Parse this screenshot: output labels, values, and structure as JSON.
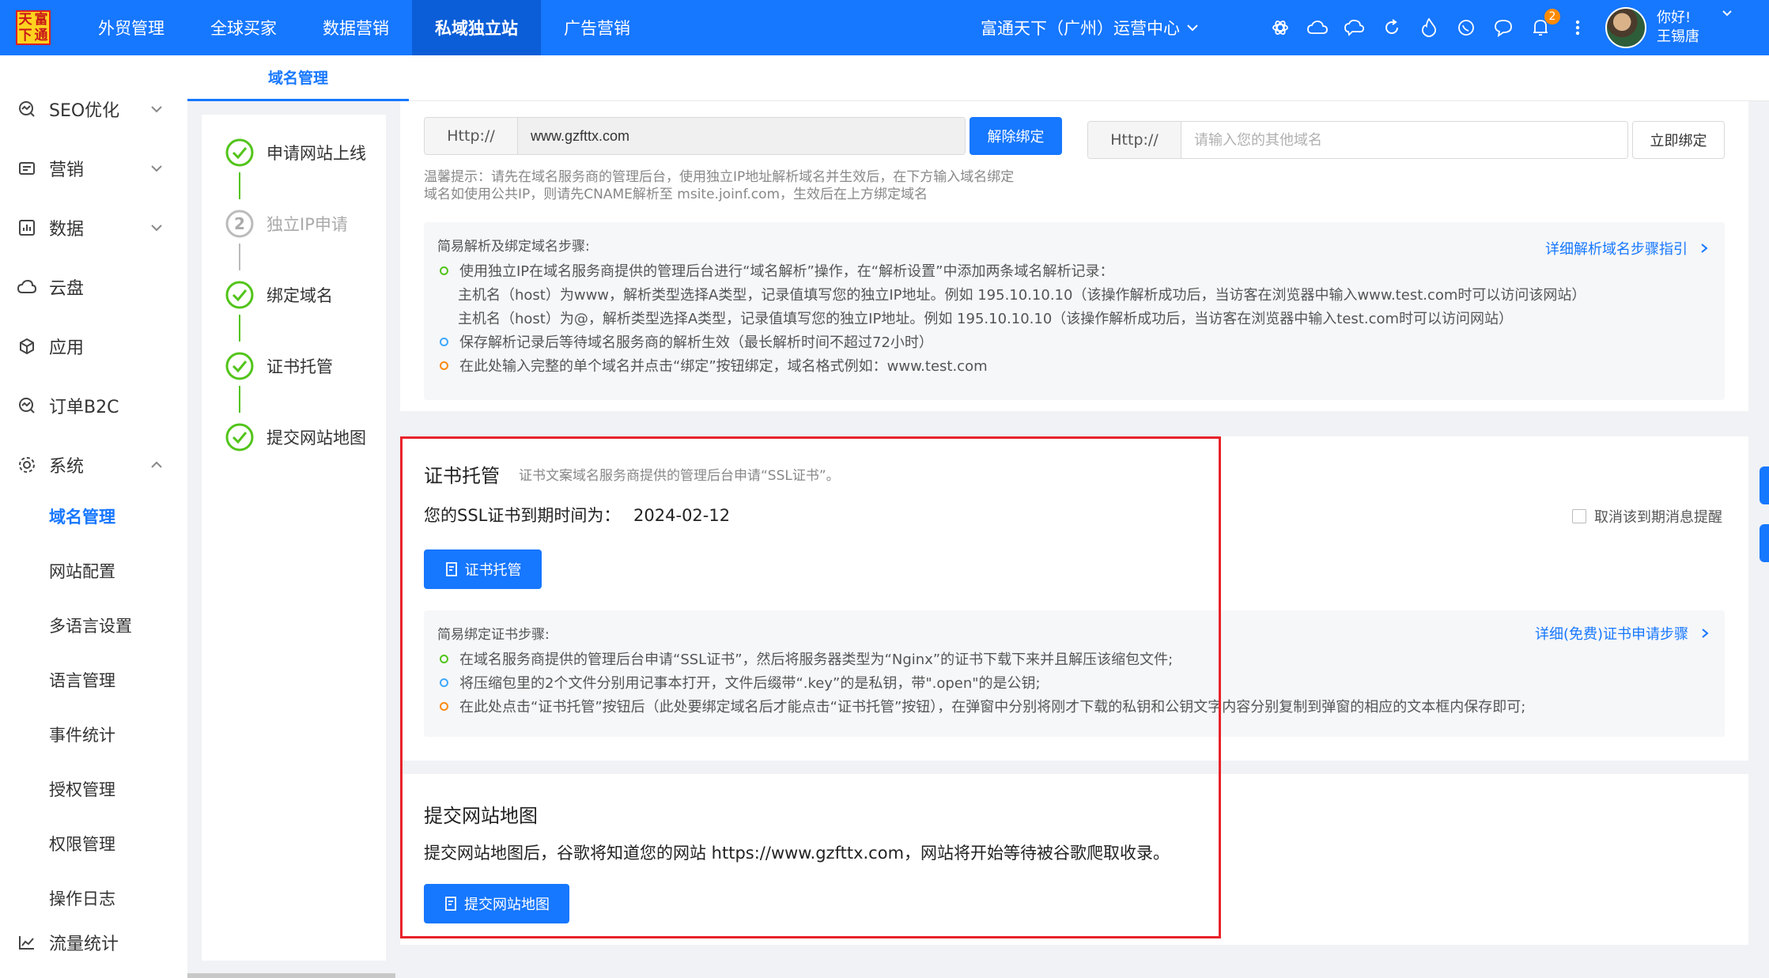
{
  "colors": {
    "primary": "#1677ff",
    "highlight": "#e8232a",
    "success": "#52c41a"
  },
  "logo": {
    "chars": [
      "天",
      "富",
      "下",
      "通"
    ]
  },
  "topnav": {
    "items": [
      "外贸管理",
      "全球买家",
      "数据营销",
      "私域独立站",
      "广告营销"
    ],
    "active": "私域独立站",
    "org": "富通天下（广州）运营中心",
    "icons": [
      "openai-icon",
      "cloud-icon",
      "cloud-chat-icon",
      "refresh-icon",
      "fire-icon",
      "whatsapp-icon",
      "chat-icon",
      "bell-icon",
      "more-icon"
    ],
    "bell_badge": "2",
    "user_greeting": "你好!",
    "user_name": "王锡唐"
  },
  "sidebar": {
    "items": [
      {
        "label": "SEO优化",
        "icon": "seo-icon",
        "expanded": false
      },
      {
        "label": "营销",
        "icon": "marketing-icon",
        "expanded": false
      },
      {
        "label": "数据",
        "icon": "data-icon",
        "expanded": false
      },
      {
        "label": "云盘",
        "icon": "cloud-disk-icon"
      },
      {
        "label": "应用",
        "icon": "app-icon"
      },
      {
        "label": "订单B2C",
        "icon": "order-icon"
      },
      {
        "label": "系统",
        "icon": "system-icon",
        "expanded": true
      },
      {
        "label": "流量统计",
        "icon": "traffic-icon"
      }
    ],
    "sub_items": [
      "域名管理",
      "网站配置",
      "多语言设置",
      "语言管理",
      "事件统计",
      "授权管理",
      "权限管理",
      "操作日志"
    ],
    "active_sub": "域名管理"
  },
  "tab": {
    "label": "域名管理"
  },
  "steps": [
    {
      "label": "申请网站上线",
      "done": true
    },
    {
      "label": "独立IP申请",
      "done": false,
      "number": "2"
    },
    {
      "label": "绑定域名",
      "done": true
    },
    {
      "label": "证书托管",
      "done": true
    },
    {
      "label": "提交网站地图",
      "done": true
    }
  ],
  "domain_bind": {
    "prefix": "Http://",
    "bound_domain": "www.gzfttx.com",
    "unbind_button": "解除绑定",
    "other_prefix": "Http://",
    "other_placeholder": "请输入您的其他域名",
    "bind_now_button": "立即绑定",
    "hint_line1": "温馨提示：请先在域名服务商的管理后台，使用独立IP地址解析域名并生效后，在下方输入域名绑定",
    "hint_line2": "域名如使用公共IP，则请先CNAME解析至 msite.joinf.com，生效后在上方绑定域名"
  },
  "dns_guide": {
    "title": "简易解析及绑定域名步骤:",
    "link": "详细解析域名步骤指引",
    "step1": "使用独立IP在域名服务商提供的管理后台进行“域名解析”操作，在“解析设置”中添加两条域名解析记录：",
    "step1_a": "主机名（host）为www，解析类型选择A类型，记录值填写您的独立IP地址。例如 195.10.10.10（该操作解析成功后，当访客在浏览器中输入www.test.com时可以访问该网站）",
    "step1_b": "主机名（host）为@，解析类型选择A类型，记录值填写您的独立IP地址。例如 195.10.10.10（该操作解析成功后，当访客在浏览器中输入test.com时可以访问网站）",
    "step2": "保存解析记录后等待域名服务商的解析生效（最长解析时间不超过72小时）",
    "step3": "在此处输入完整的单个域名并点击“绑定”按钮绑定，域名格式例如：www.test.com"
  },
  "cert": {
    "title": "证书托管",
    "subtitle": "证书文案域名服务商提供的管理后台申请“SSL证书”。",
    "expiry_label": "您的SSL证书到期时间为：",
    "expiry_date": "2024-02-12",
    "cancel_reminder": "取消该到期消息提醒",
    "button": "证书托管",
    "guide_title": "简易绑定证书步骤:",
    "guide_link": "详细(免费)证书申请步骤",
    "step1": "在域名服务商提供的管理后台申请“SSL证书”，然后将服务器类型为“Nginx”的证书下载下来并且解压该缩包文件;",
    "step2": "将压缩包里的2个文件分别用记事本打开，文件后缀带“.key”的是私钥，带\".open\"的是公钥;",
    "step3": "在此处点击“证书托管”按钮后（此处要绑定域名后才能点击“证书托管”按钮），在弹窗中分别将刚才下载的私钥和公钥文字内容分别复制到弹窗的相应的文本框内保存即可;"
  },
  "sitemap": {
    "title": "提交网站地图",
    "desc": "提交网站地图后，谷歌将知道您的网站 https://www.gzfttx.com，网站将开始等待被谷歌爬取收录。",
    "button": "提交网站地图"
  }
}
